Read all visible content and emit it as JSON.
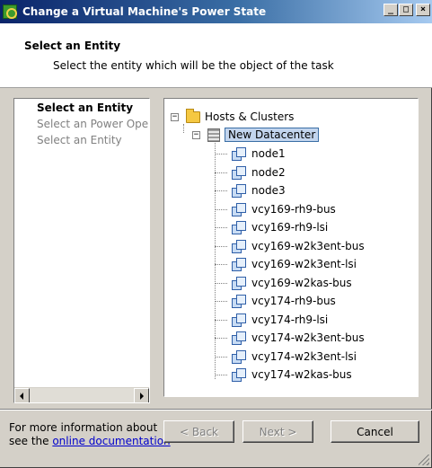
{
  "window": {
    "title": "Change a Virtual Machine's Power State",
    "buttons": {
      "minimize": "_",
      "maximize": "□",
      "close": "×"
    }
  },
  "header": {
    "title": "Select an Entity",
    "description": "Select the entity which will be the object of the task"
  },
  "steps": [
    {
      "label": "Select an Entity",
      "state": "current"
    },
    {
      "label": "Select an Power Operation",
      "state": "pending"
    },
    {
      "label": "Select an Entity",
      "state": "pending"
    }
  ],
  "tree": {
    "root": {
      "label": "Hosts & Clusters",
      "icon": "folder-icon",
      "expanded": true
    },
    "datacenter": {
      "label": "New Datacenter",
      "icon": "datacenter-icon",
      "expanded": true,
      "selected": true
    },
    "vms": [
      "node1",
      "node2",
      "node3",
      "vcy169-rh9-bus",
      "vcy169-rh9-lsi",
      "vcy169-w2k3ent-bus",
      "vcy169-w2k3ent-lsi",
      "vcy169-w2kas-bus",
      "vcy174-rh9-bus",
      "vcy174-rh9-lsi",
      "vcy174-w2k3ent-bus",
      "vcy174-w2k3ent-lsi",
      "vcy174-w2kas-bus"
    ]
  },
  "footer": {
    "info_line1": "For more information about",
    "info_line2_prefix": "see the ",
    "info_link": "online documentation",
    "back_label": "< Back",
    "next_label": "Next >",
    "cancel_label": "Cancel"
  },
  "colors": {
    "titlebar_start": "#0a246a",
    "titlebar_end": "#a6caf0",
    "dialog_face": "#d4d0c8",
    "selection": "#c3d5ee",
    "link": "#0000cc"
  }
}
